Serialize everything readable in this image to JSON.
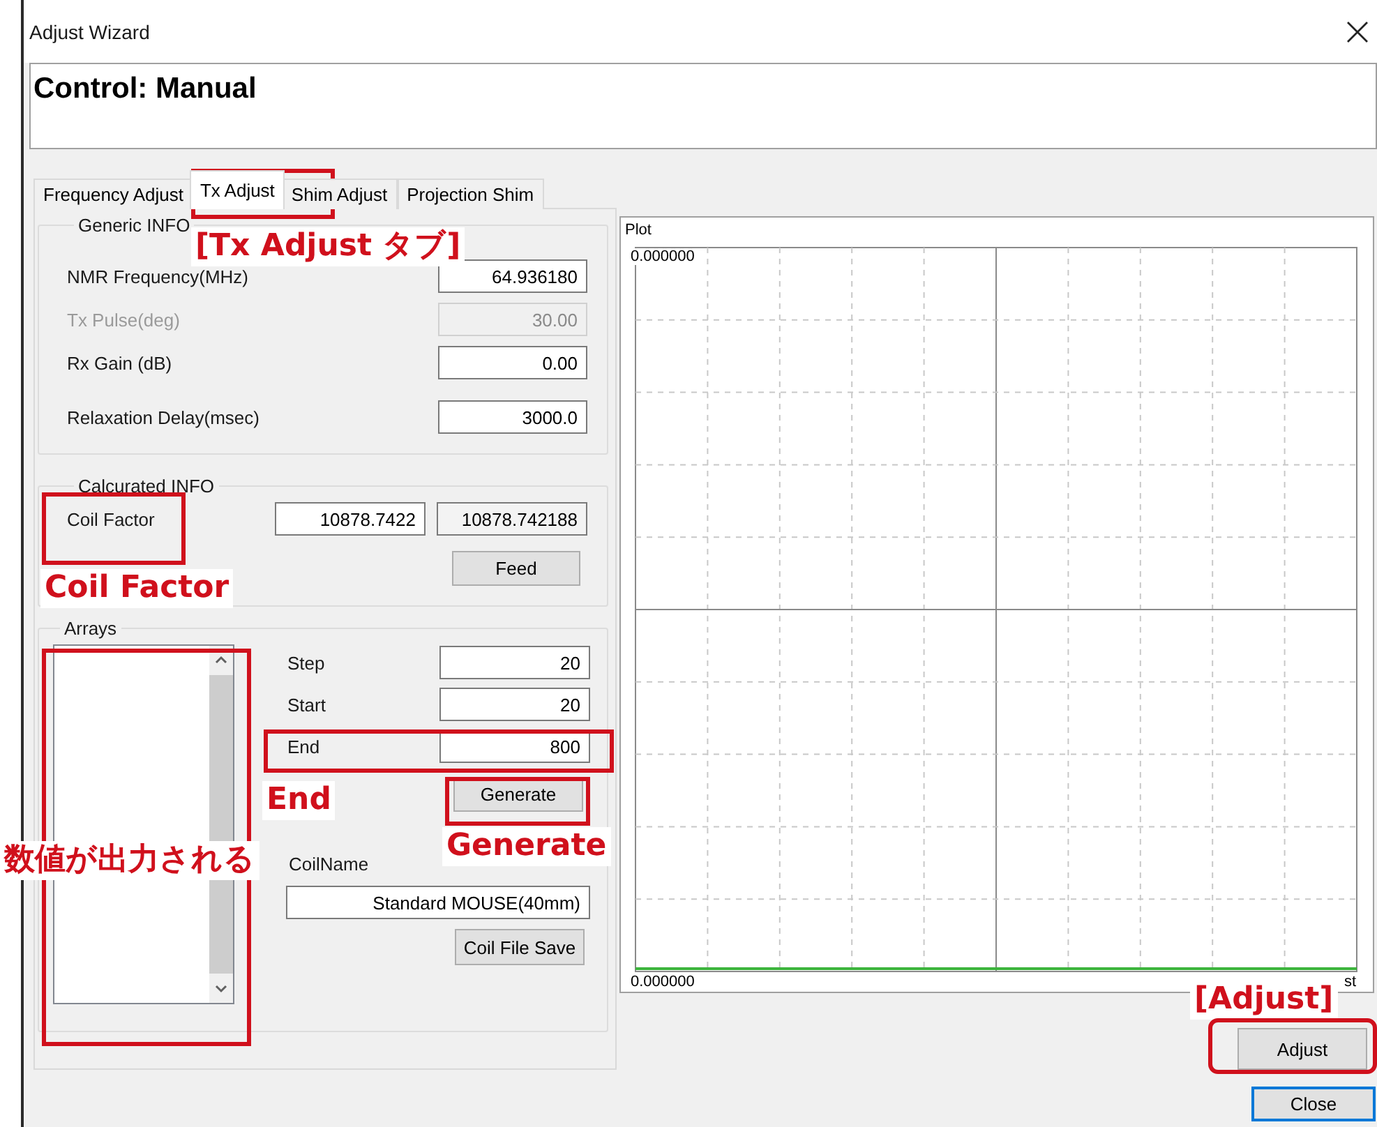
{
  "window": {
    "title": "Adjust Wizard"
  },
  "header": {
    "text": "Control: Manual"
  },
  "tabs": [
    {
      "label": "Frequency Adjust",
      "selected": false
    },
    {
      "label": "Tx Adjust",
      "selected": true
    },
    {
      "label": "Shim Adjust",
      "selected": false
    },
    {
      "label": "Projection Shim",
      "selected": false
    }
  ],
  "generic_info": {
    "title": "Generic INFO",
    "fields": [
      {
        "label": "NMR Frequency(MHz)",
        "value": "64.936180",
        "disabled": false
      },
      {
        "label": "Tx Pulse(deg)",
        "value": "30.00",
        "disabled": true
      },
      {
        "label": "Rx Gain (dB)",
        "value": "0.00",
        "disabled": false
      },
      {
        "label": "Relaxation Delay(msec)",
        "value": "3000.0",
        "disabled": false
      }
    ]
  },
  "calculated_info": {
    "title": "Calcurated INFO",
    "label": "Coil Factor",
    "values": [
      {
        "value": "10878.7422",
        "readonly": false
      },
      {
        "value": "10878.742188",
        "readonly": true
      }
    ],
    "button": "Feed"
  },
  "arrays": {
    "title": "Arrays",
    "fields": [
      {
        "label": "Step",
        "value": "20"
      },
      {
        "label": "Start",
        "value": "20"
      },
      {
        "label": "End",
        "value": "800"
      }
    ],
    "generate_button": "Generate",
    "coil_name_label": "CoilName",
    "coil_name_value": "Standard MOUSE(40mm)",
    "save_button": "Coil File Save"
  },
  "plot": {
    "title": "Plot",
    "y_top_label": "0.000000",
    "y_bottom_label": "0.000000",
    "x_label_fragment": "st"
  },
  "buttons": [
    {
      "label": "Adjust",
      "default": false
    },
    {
      "label": "Close",
      "default": true
    }
  ],
  "annotations": [
    {
      "kind": "highlight"
    },
    {
      "kind": "label",
      "text": "[Tx Adjust タブ]"
    },
    {
      "kind": "highlight"
    },
    {
      "kind": "label",
      "text": "Coil Factor"
    },
    {
      "kind": "highlight"
    },
    {
      "kind": "highlight"
    },
    {
      "kind": "label",
      "text": "End"
    },
    {
      "kind": "highlight"
    },
    {
      "kind": "label",
      "text": "Generate"
    },
    {
      "kind": "label",
      "text": "数値が出力される"
    },
    {
      "kind": "label",
      "text": "[Adjust]"
    },
    {
      "kind": "highlight"
    }
  ]
}
